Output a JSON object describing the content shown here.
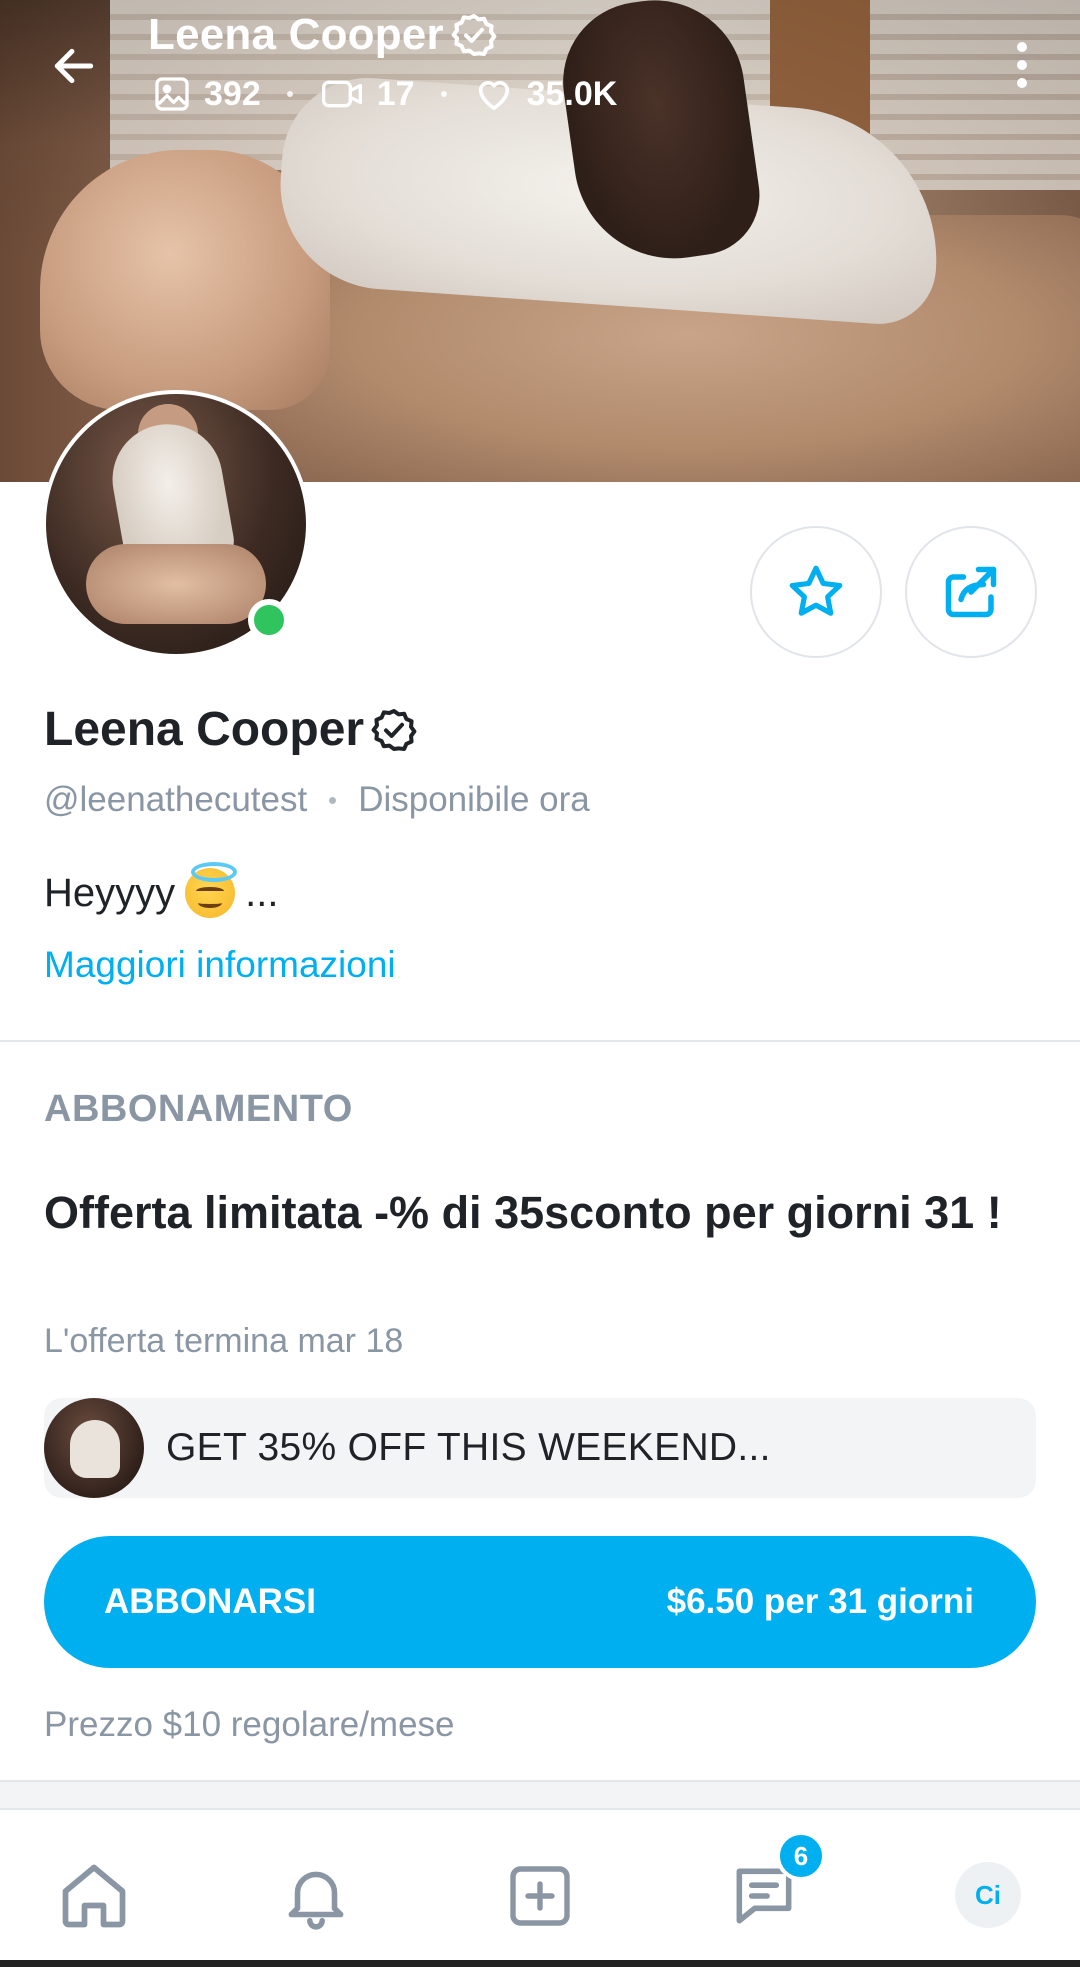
{
  "cover": {
    "name": "Leena Cooper",
    "stats": {
      "photos": "392",
      "videos": "17",
      "likes": "35.0K"
    }
  },
  "profile": {
    "name": "Leena Cooper",
    "handle": "@leenathecutest",
    "status": "Disponibile ora",
    "bio": "Heyyyy",
    "bio_suffix": "...",
    "more_info": "Maggiori informazioni"
  },
  "subscription": {
    "section_label": "ABBONAMENTO",
    "offer_title": "Offerta limitata -% di 35sconto per giorni 31 !",
    "offer_ends": "L'offerta termina mar 18",
    "promo_text": "GET 35% OFF THIS WEEKEND...",
    "button_label": "ABBONARSI",
    "button_price": "$6.50 per 31 giorni",
    "regular_price": "Prezzo $10 regolare/mese"
  },
  "bottom_nav": {
    "messages_badge": "6",
    "avatar_initials": "Ci"
  },
  "colors": {
    "accent": "#00aff0",
    "online": "#2fc45d",
    "muted_text": "#8a96a3"
  },
  "icons": {
    "back": "arrow-left-icon",
    "more": "more-vertical-icon",
    "verified": "verified-badge-icon",
    "photos": "image-icon",
    "videos": "video-camera-icon",
    "likes": "heart-icon",
    "favorite": "star-icon",
    "share": "share-icon",
    "home": "home-icon",
    "notifications": "bell-icon",
    "add": "plus-square-icon",
    "messages": "message-icon"
  }
}
